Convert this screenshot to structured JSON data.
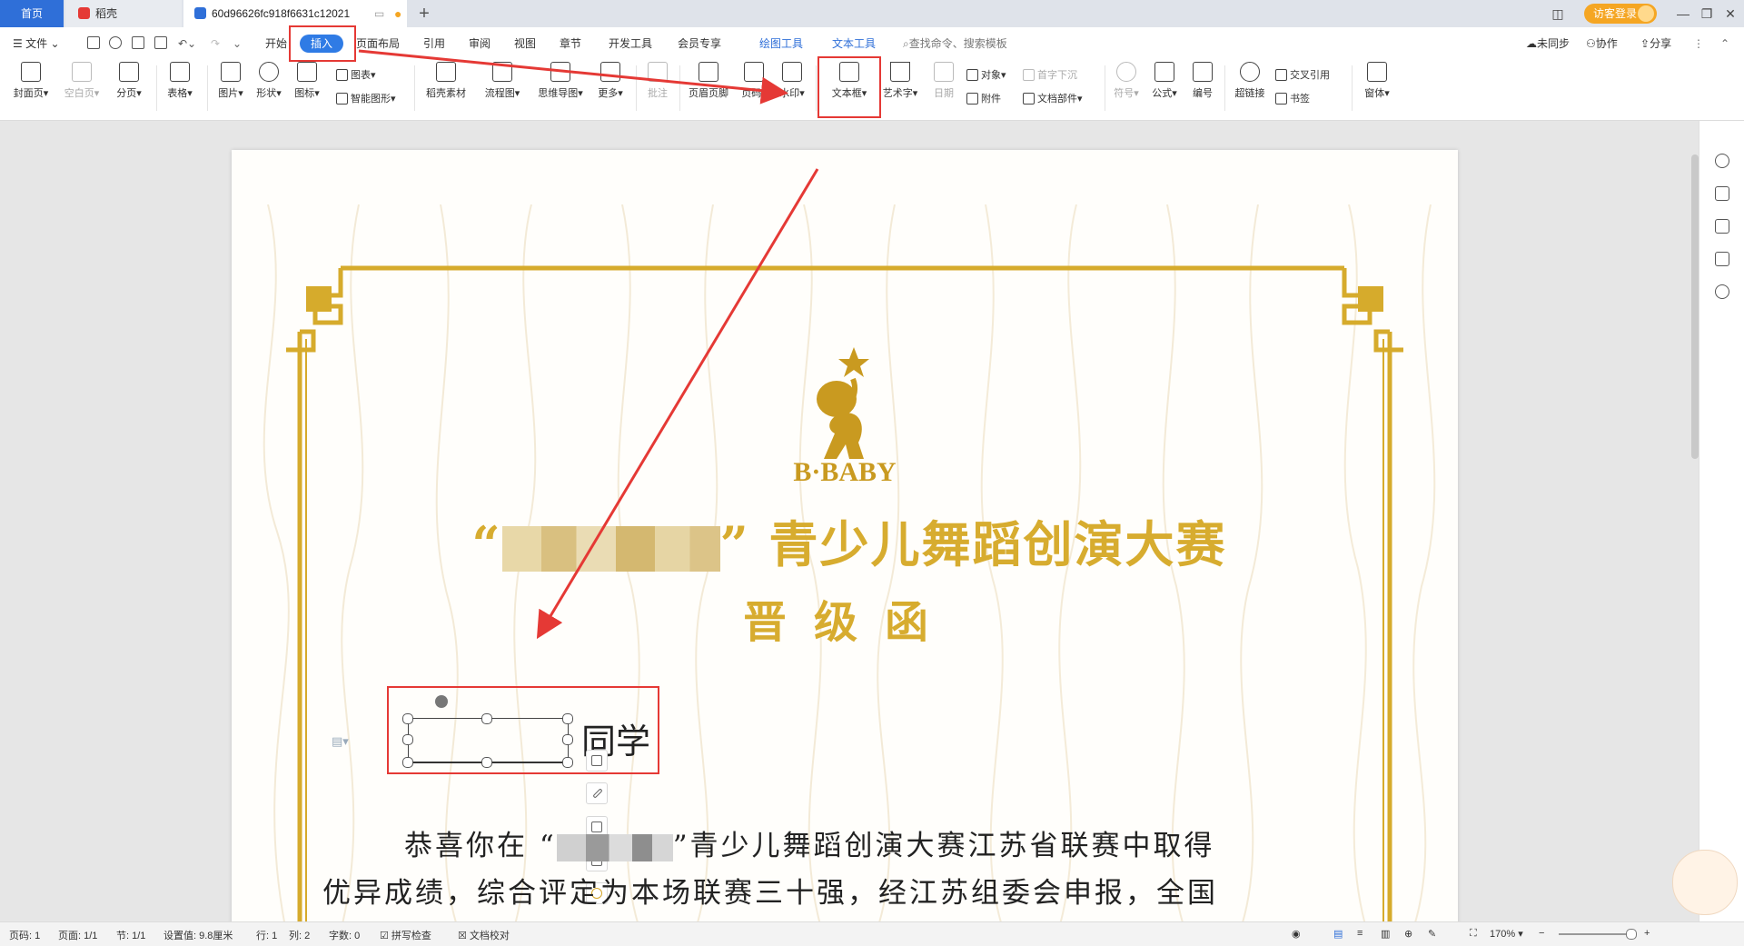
{
  "tabs": {
    "home": "首页",
    "daoke": "稻壳",
    "doc": "60d96626fc918f6631c12021"
  },
  "window": {
    "login": "访客登录"
  },
  "menu": {
    "file": "文件",
    "items": [
      "开始",
      "插入",
      "页面布局",
      "引用",
      "审阅",
      "视图",
      "章节",
      "开发工具",
      "会员专享"
    ],
    "drawing_tools": "绘图工具",
    "text_tools": "文本工具",
    "search_placeholder": "查找命令、搜索模板",
    "unsync": "未同步",
    "collab": "协作",
    "share": "分享"
  },
  "ribbon": {
    "cover": "封面页",
    "blank": "空白页",
    "pagebreak": "分页",
    "table": "表格",
    "picture": "图片",
    "shape": "形状",
    "icon": "图标",
    "chart": "图表",
    "smart": "智能图形",
    "material": "稻壳素材",
    "flow": "流程图",
    "mindmap": "思维导图",
    "more": "更多",
    "comment": "批注",
    "header_footer": "页眉页脚",
    "page_number": "页码",
    "watermark": "水印",
    "textbox": "文本框",
    "wordart": "艺术字",
    "date": "日期",
    "object": "对象",
    "attachment": "附件",
    "dropcap": "首字下沉",
    "docparts": "文档部件",
    "symbol": "符号",
    "formula": "公式",
    "numbering": "编号",
    "crossref": "交叉引用",
    "hyperlink": "超链接",
    "bookmark": "书签",
    "window_body": "窗体"
  },
  "certificate": {
    "brand": "B·BABY",
    "title_quote_open": "“",
    "title_quote_close": "”",
    "title_rest": "青少儿舞蹈创演大赛",
    "subtitle": "晋级函",
    "classmate": "同学",
    "line1_start": "恭喜你在",
    "line1_end": "”青少儿舞蹈创演大赛江苏省联赛中取得",
    "line2": "优异成绩，综合评定为本场联赛三十强，经江苏组委会申报，全国"
  },
  "status": {
    "page_no": "页码: 1",
    "pages": "页面: 1/1",
    "section": "节: 1/1",
    "setting": "设置值: 9.8厘米",
    "row": "行: 1",
    "col": "列: 2",
    "words": "字数: 0",
    "spell": "拼写检查",
    "proof": "文档校对",
    "zoom": "170%"
  }
}
